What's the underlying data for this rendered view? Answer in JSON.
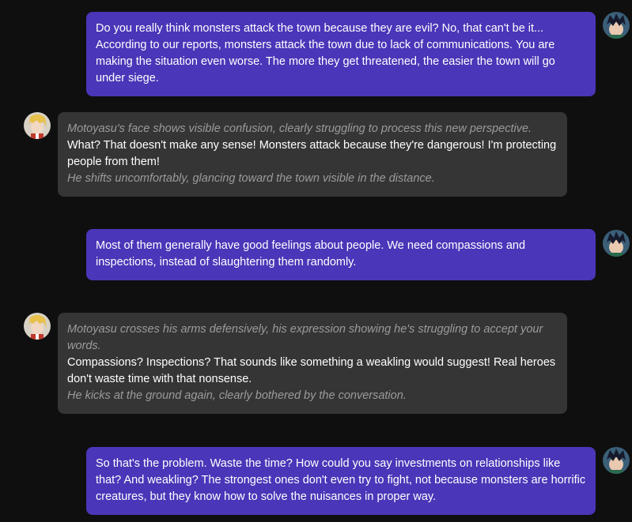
{
  "messages": [
    {
      "role": "user",
      "avatar_icon": "dark-haired-hero-avatar-icon",
      "text": "Do you really think monsters attack the town because they are evil? No, that can't be it... According to our reports, monsters attack the town due to lack of communications. You are making the situation even worse. The more they get threatened, the easier the town will go under siege."
    },
    {
      "role": "character",
      "avatar_icon": "blonde-hero-avatar-icon",
      "action_1": "Motoyasu's face shows visible confusion, clearly struggling to process this new perspective.",
      "speech": "What? That doesn't make any sense! Monsters attack because they're dangerous! I'm protecting people from them!",
      "action_2": "He shifts uncomfortably, glancing toward the town visible in the distance."
    },
    {
      "role": "user",
      "avatar_icon": "dark-haired-hero-avatar-icon",
      "text": "Most of them generally have good feelings about people. We need compassions and inspections, instead of slaughtering them randomly."
    },
    {
      "role": "character",
      "avatar_icon": "blonde-hero-avatar-icon",
      "action_1": "Motoyasu crosses his arms defensively, his expression showing he's struggling to accept your words.",
      "speech": "Compassions? Inspections? That sounds like something a weakling would suggest! Real heroes don't waste time with that nonsense.",
      "action_2": "He kicks at the ground again, clearly bothered by the conversation."
    },
    {
      "role": "user",
      "avatar_icon": "dark-haired-hero-avatar-icon",
      "text": "So that's the problem. Waste the time? How could you say investments on relationships like that? And weakling? The strongest ones don't even try to fight, not because monsters are horrific creatures, but they know how to solve the nuisances in proper way."
    }
  ],
  "colors": {
    "background": "#0f0f0f",
    "user_bubble": "#4a36b8",
    "character_bubble": "#353535",
    "action_text": "#9b9b9b",
    "speech_text": "#ffffff"
  }
}
